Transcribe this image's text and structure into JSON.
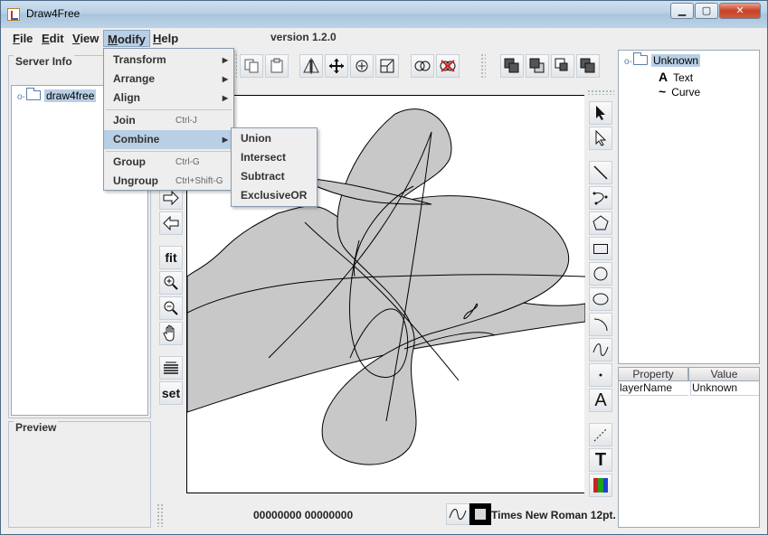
{
  "window": {
    "title": "Draw4Free",
    "minimize": "▁",
    "maximize": "▢",
    "close": "✕"
  },
  "menubar": {
    "items": [
      {
        "label": "File",
        "key": "F",
        "rest": "ile"
      },
      {
        "label": "Edit",
        "key": "E",
        "rest": "dit"
      },
      {
        "label": "View",
        "key": "V",
        "rest": "iew"
      },
      {
        "label": "Modify",
        "key": "M",
        "rest": "odify"
      },
      {
        "label": "Help",
        "key": "H",
        "rest": "elp"
      }
    ],
    "version": "version 1.2.0"
  },
  "server_info": {
    "title": "Server Info",
    "tree_root": "draw4free"
  },
  "preview": {
    "title": "Preview"
  },
  "modify_menu": {
    "items": [
      {
        "label": "Transform",
        "submenu": true
      },
      {
        "label": "Arrange",
        "submenu": true
      },
      {
        "label": "Align",
        "submenu": true
      },
      {
        "label": "Join",
        "accel": "Ctrl-J"
      },
      {
        "label": "Combine",
        "submenu": true
      },
      {
        "label": "Group",
        "accel": "Ctrl-G"
      },
      {
        "label": "Ungroup",
        "accel": "Ctrl+Shift-G"
      }
    ]
  },
  "combine_submenu": {
    "items": [
      "Union",
      "Intersect",
      "Subtract",
      "ExclusiveOR"
    ]
  },
  "left_tools": {
    "fit": "fit",
    "set": "set"
  },
  "right_tools": {
    "text_tool": "A",
    "text_tool2": "T"
  },
  "layer_tree": {
    "root": "Unknown",
    "children": [
      {
        "icon": "A",
        "label": "Text"
      },
      {
        "icon": "~",
        "label": "Curve"
      }
    ]
  },
  "properties": {
    "headers": [
      "Property",
      "Value"
    ],
    "rows": [
      {
        "property": "layerName",
        "value": "Unknown"
      }
    ]
  },
  "status_bar": {
    "coordinates": "00000000  00000000",
    "font": "Times New Roman 12pt."
  },
  "colors": {
    "shape_fill": "#c8c8c8",
    "highlight": "#b8cfe5"
  }
}
